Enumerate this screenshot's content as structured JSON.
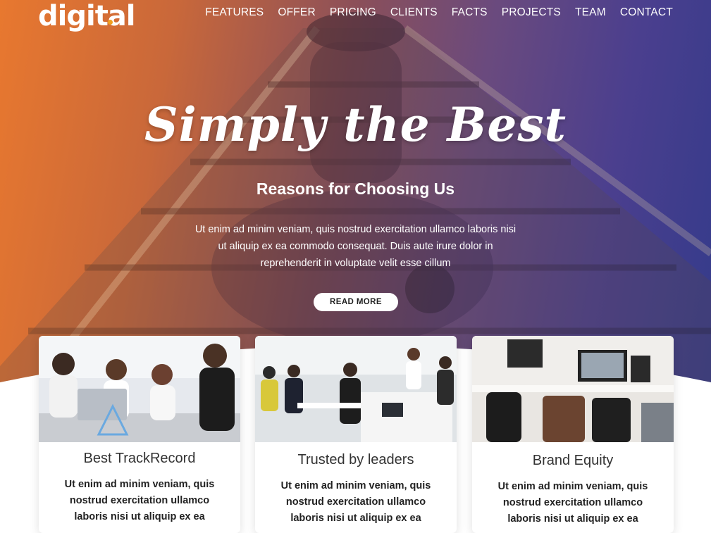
{
  "brand": {
    "logo": "digital",
    "accent": "#f0a020"
  },
  "nav": [
    "FEATURES",
    "OFFER",
    "PRICING",
    "CLIENTS",
    "FACTS",
    "PROJECTS",
    "TEAM",
    "CONTACT"
  ],
  "hero": {
    "title": "Simply the Best",
    "subtitle": "Reasons for Choosing Us",
    "text": "Ut enim ad minim veniam, quis nostrud exercitation ullamco laboris nisi ut aliquip ex ea commodo consequat. Duis aute irure dolor in reprehenderit in voluptate velit esse cillum",
    "button": "READ MORE",
    "gradient": [
      "#e8782f",
      "#6a4a7e",
      "#303a8a"
    ]
  },
  "cards": [
    {
      "title": "Best TrackRecord",
      "text": "Ut enim ad minim veniam, quis nostrud exercitation ullamco laboris nisi ut aliquip ex ea"
    },
    {
      "title": "Trusted by leaders",
      "text": "Ut enim ad minim veniam, quis nostrud exercitation ullamco laboris nisi ut aliquip ex ea"
    },
    {
      "title": "Brand Equity",
      "text": "Ut enim ad minim veniam, quis nostrud exercitation ullamco laboris nisi ut aliquip ex ea"
    }
  ]
}
